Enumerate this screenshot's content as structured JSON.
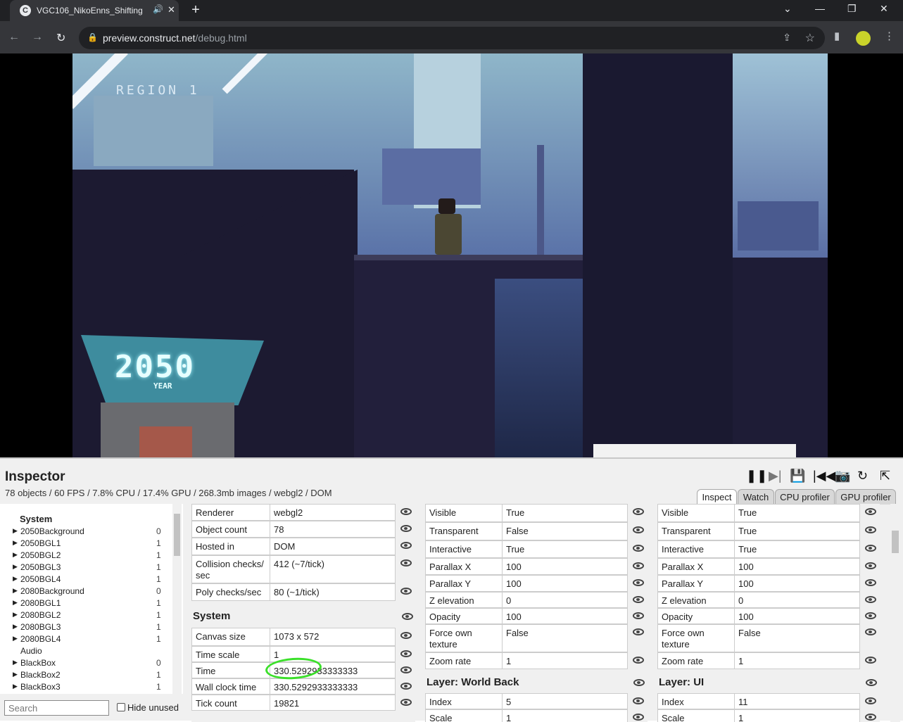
{
  "browser": {
    "tab_title": "VGC106_NikoEnns_Shifting",
    "url_host": "preview.construct.net",
    "url_path": "/debug.html",
    "new_tab": "+",
    "favicon_letter": "C"
  },
  "game": {
    "region_label": "REGION 1",
    "year_big": "2050",
    "year_small": "YEAR"
  },
  "inspector": {
    "title": "Inspector",
    "stats": "78 objects / 60 FPS / 7.8% CPU / 17.4% GPU / 268.3mb images / webgl2 / DOM",
    "tabs": [
      "Inspect",
      "Watch",
      "CPU profiler",
      "GPU profiler"
    ],
    "active_tab": "Inspect",
    "search_placeholder": "Search",
    "hide_unused": "Hide unused",
    "tree": {
      "header": "System",
      "items": [
        {
          "name": "2050Background",
          "count": "0",
          "expand": true
        },
        {
          "name": "2050BGL1",
          "count": "1",
          "expand": true
        },
        {
          "name": "2050BGL2",
          "count": "1",
          "expand": true
        },
        {
          "name": "2050BGL3",
          "count": "1",
          "expand": true
        },
        {
          "name": "2050BGL4",
          "count": "1",
          "expand": true
        },
        {
          "name": "2080Background",
          "count": "0",
          "expand": true
        },
        {
          "name": "2080BGL1",
          "count": "1",
          "expand": true
        },
        {
          "name": "2080BGL2",
          "count": "1",
          "expand": true
        },
        {
          "name": "2080BGL3",
          "count": "1",
          "expand": true
        },
        {
          "name": "2080BGL4",
          "count": "1",
          "expand": true
        },
        {
          "name": "Audio",
          "count": "",
          "expand": false
        },
        {
          "name": "BlackBox",
          "count": "0",
          "expand": true
        },
        {
          "name": "BlackBox2",
          "count": "1",
          "expand": true
        },
        {
          "name": "BlackBox3",
          "count": "1",
          "expand": true
        }
      ]
    },
    "col1": {
      "rows_top": [
        {
          "k": "Renderer",
          "v": "webgl2"
        },
        {
          "k": "Object count",
          "v": "78"
        },
        {
          "k": "Hosted in",
          "v": "DOM"
        },
        {
          "k": "Collision checks/ sec",
          "v": "412 (~7/tick)"
        },
        {
          "k": "Poly checks/sec",
          "v": "80 (~1/tick)"
        }
      ],
      "section": "System",
      "rows_sys": [
        {
          "k": "Canvas size",
          "v": "1073 x 572"
        },
        {
          "k": "Time scale",
          "v": "1"
        },
        {
          "k": "Time",
          "v": "330.5292933333333"
        },
        {
          "k": "Wall clock time",
          "v": "330.5292933333333"
        },
        {
          "k": "Tick count",
          "v": "19821"
        }
      ]
    },
    "col2": {
      "rows": [
        {
          "k": "Visible",
          "v": "True"
        },
        {
          "k": "Transparent",
          "v": "False"
        },
        {
          "k": "Interactive",
          "v": "True"
        },
        {
          "k": "Parallax X",
          "v": "100"
        },
        {
          "k": "Parallax Y",
          "v": "100"
        },
        {
          "k": "Z elevation",
          "v": "0"
        },
        {
          "k": "Opacity",
          "v": "100"
        },
        {
          "k": "Force own texture",
          "v": "False"
        },
        {
          "k": "Zoom rate",
          "v": "1"
        }
      ],
      "section": "Layer: World Back",
      "rows2": [
        {
          "k": "Index",
          "v": "5"
        },
        {
          "k": "Scale",
          "v": "1"
        }
      ]
    },
    "col3": {
      "rows": [
        {
          "k": "Visible",
          "v": "True"
        },
        {
          "k": "Transparent",
          "v": "True"
        },
        {
          "k": "Interactive",
          "v": "True"
        },
        {
          "k": "Parallax X",
          "v": "100"
        },
        {
          "k": "Parallax Y",
          "v": "100"
        },
        {
          "k": "Z elevation",
          "v": "0"
        },
        {
          "k": "Opacity",
          "v": "100"
        },
        {
          "k": "Force own texture",
          "v": "False"
        },
        {
          "k": "Zoom rate",
          "v": "1"
        }
      ],
      "section": "Layer: UI",
      "rows2": [
        {
          "k": "Index",
          "v": "11"
        },
        {
          "k": "Scale",
          "v": "1"
        }
      ]
    }
  }
}
